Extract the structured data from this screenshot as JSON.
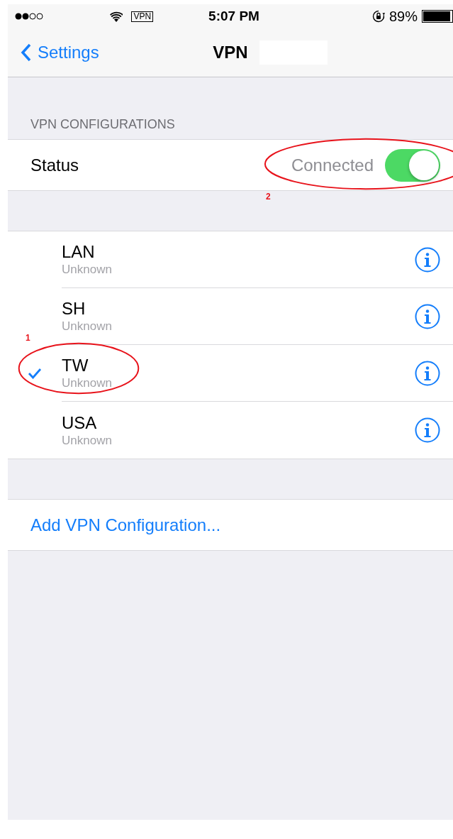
{
  "status_bar": {
    "vpn_badge": "VPN",
    "time": "5:07 PM",
    "battery": "89%"
  },
  "nav_bar": {
    "back": "Settings",
    "title": "VPN"
  },
  "section_header": "VPN CONFIGURATIONS",
  "status": {
    "label": "Status",
    "value": "Connected",
    "on": true,
    "annotation": "2"
  },
  "configurations": [
    {
      "name": "LAN",
      "status": "Unknown",
      "selected": false
    },
    {
      "name": "SH",
      "status": "Unknown",
      "selected": false
    },
    {
      "name": "TW",
      "status": "Unknown",
      "selected": true,
      "annotation": "1"
    },
    {
      "name": "USA",
      "status": "Unknown",
      "selected": false
    }
  ],
  "add_button": "Add VPN Configuration..."
}
